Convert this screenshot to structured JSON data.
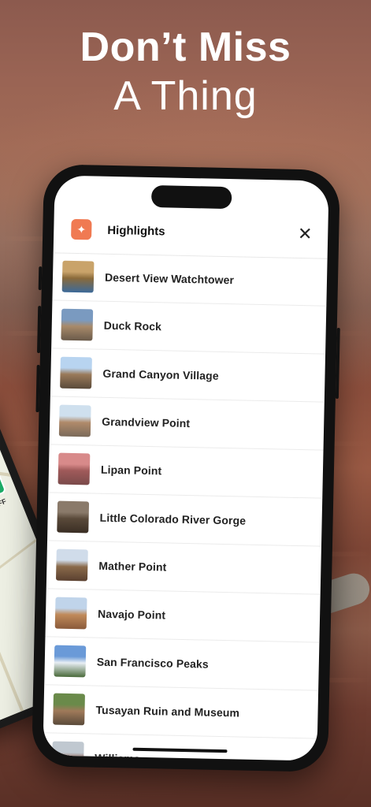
{
  "headline": {
    "line1": "Don’t Miss",
    "line2": "A Thing"
  },
  "map": {
    "label": "FLAGSTAFF"
  },
  "panel": {
    "title": "Highlights",
    "close_icon": "close-icon",
    "app_icon": "map-pin-icon"
  },
  "highlights": [
    {
      "name": "Desert View Watchtower",
      "thumb": [
        "#c9a36a",
        "#8a6a3a",
        "#3c6a9a"
      ]
    },
    {
      "name": "Duck Rock",
      "thumb": [
        "#7a9ac0",
        "#a88a6a",
        "#6a5a4a"
      ]
    },
    {
      "name": "Grand Canyon Village",
      "thumb": [
        "#b8d4f0",
        "#9a7a5a",
        "#5a4a3a"
      ]
    },
    {
      "name": "Grandview Point",
      "thumb": [
        "#cfe0ee",
        "#b08a6a",
        "#7a6a5a"
      ]
    },
    {
      "name": "Lipan Point",
      "thumb": [
        "#d88a8a",
        "#a05a5a",
        "#7a4a4a"
      ]
    },
    {
      "name": "Little Colorado River Gorge",
      "thumb": [
        "#8a7a6a",
        "#5a4a3a",
        "#3a2e24"
      ]
    },
    {
      "name": "Mather Point",
      "thumb": [
        "#d0dcea",
        "#8a6a4a",
        "#5a4030"
      ]
    },
    {
      "name": "Navajo Point",
      "thumb": [
        "#c0d4ea",
        "#c08a5a",
        "#8a5a3a"
      ]
    },
    {
      "name": "San Francisco Peaks",
      "thumb": [
        "#6a9ad8",
        "#e8eef4",
        "#4a6a3a"
      ]
    },
    {
      "name": "Tusayan Ruin and Museum",
      "thumb": [
        "#6a8a4a",
        "#a07a5a",
        "#5a4a3a"
      ]
    },
    {
      "name": "Williams",
      "thumb": [
        "#c0c8d0",
        "#8a5a4a",
        "#4a4a4a"
      ]
    }
  ]
}
